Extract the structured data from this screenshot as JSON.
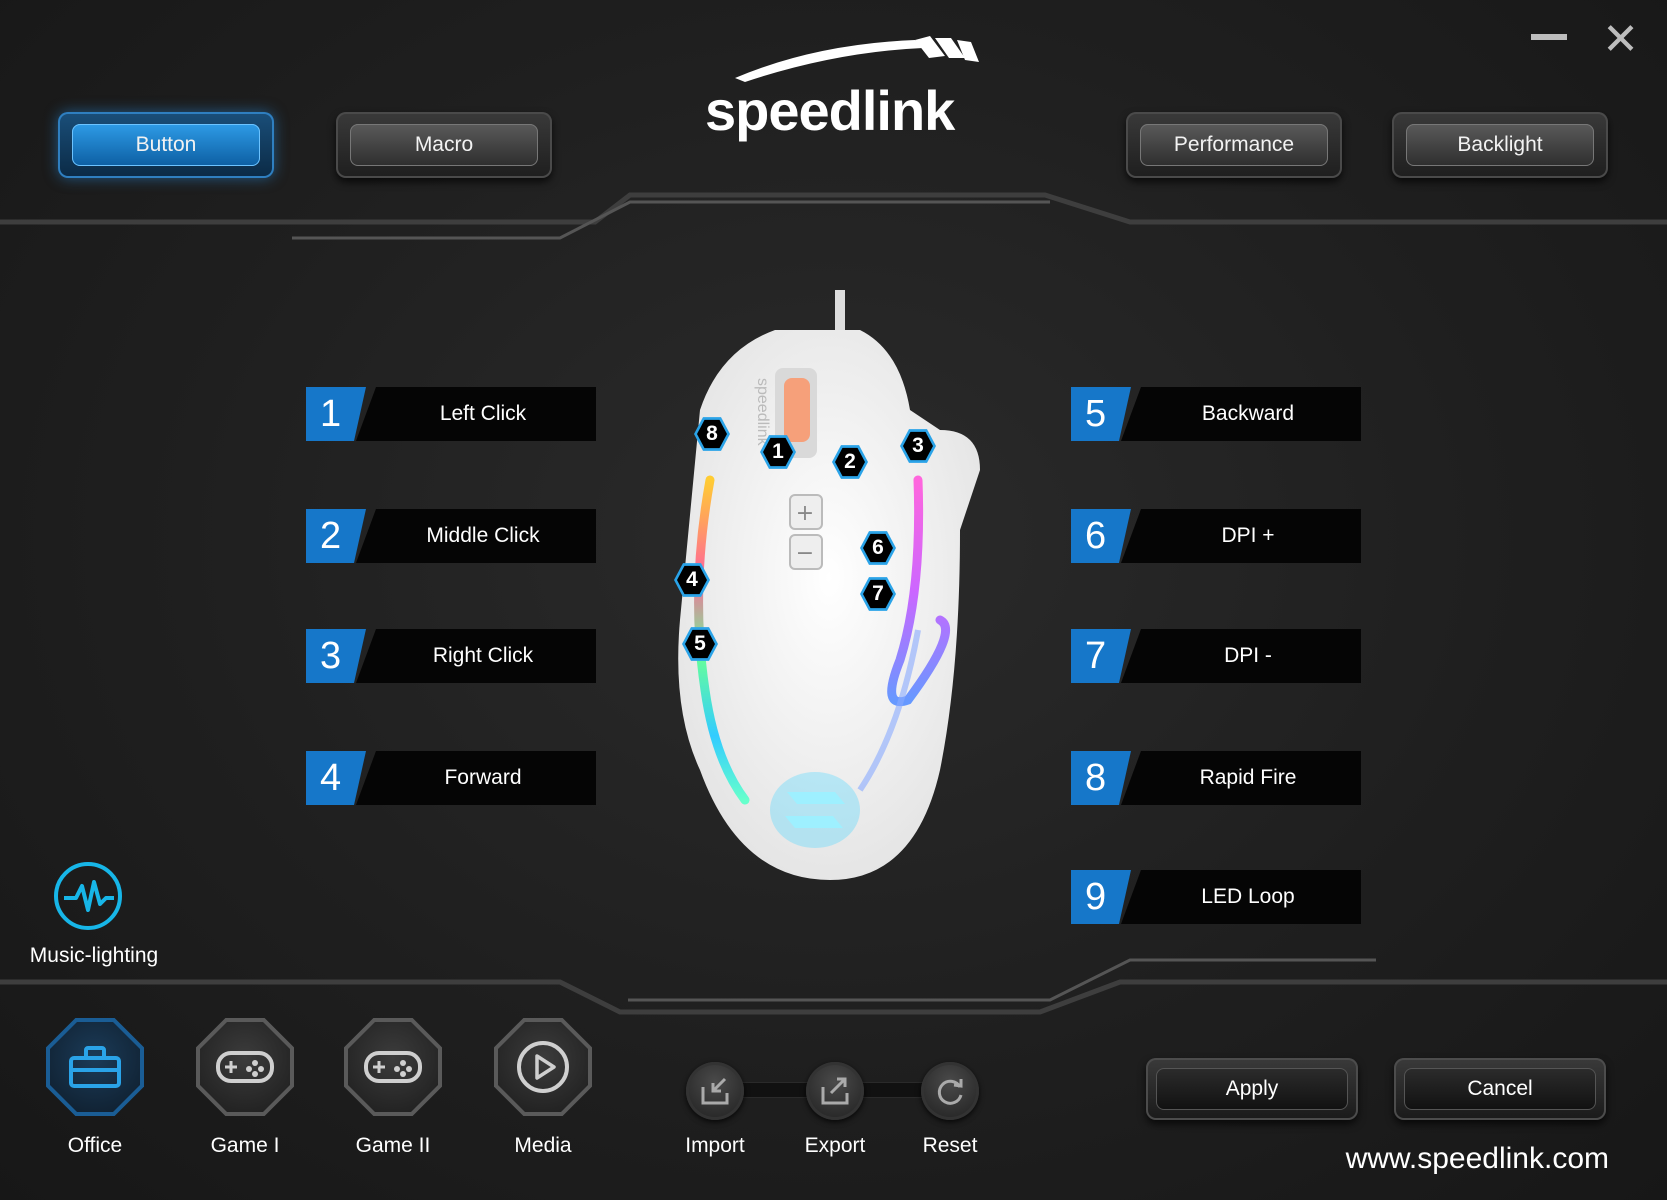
{
  "window": {
    "minimize_icon": "minimize-icon",
    "close_icon": "close-icon",
    "close_glyph": "✕"
  },
  "logo": {
    "text": "speedlink"
  },
  "tabs": [
    {
      "label": "Button",
      "active": true
    },
    {
      "label": "Macro",
      "active": false
    },
    {
      "label": "Performance",
      "active": false
    },
    {
      "label": "Backlight",
      "active": false
    }
  ],
  "mappings_left": [
    {
      "num": "1",
      "label": "Left Click"
    },
    {
      "num": "2",
      "label": "Middle Click"
    },
    {
      "num": "3",
      "label": "Right Click"
    },
    {
      "num": "4",
      "label": "Forward"
    }
  ],
  "mappings_right": [
    {
      "num": "5",
      "label": "Backward"
    },
    {
      "num": "6",
      "label": "DPI +"
    },
    {
      "num": "7",
      "label": "DPI -"
    },
    {
      "num": "8",
      "label": "Rapid Fire"
    },
    {
      "num": "9",
      "label": "LED Loop"
    }
  ],
  "mouse": {
    "brand_text": "speedlink",
    "markers": [
      "8",
      "1",
      "2",
      "3",
      "6",
      "4",
      "7",
      "5"
    ],
    "dpi_plus": "+",
    "dpi_minus": "−"
  },
  "music_lighting": {
    "label": "Music-lighting",
    "icon": "waveform-icon"
  },
  "profiles": [
    {
      "label": "Office",
      "icon": "toolbox-icon",
      "active": true
    },
    {
      "label": "Game I",
      "icon": "gamepad-icon",
      "active": false
    },
    {
      "label": "Game II",
      "icon": "gamepad-icon",
      "active": false
    },
    {
      "label": "Media",
      "icon": "play-icon",
      "active": false
    }
  ],
  "file_actions": [
    {
      "label": "Import",
      "icon": "import-icon"
    },
    {
      "label": "Export",
      "icon": "export-icon"
    },
    {
      "label": "Reset",
      "icon": "reset-icon"
    }
  ],
  "buttons": {
    "apply": "Apply",
    "cancel": "Cancel"
  },
  "website": "www.speedlink.com",
  "colors": {
    "accent": "#1677c9",
    "glow": "#2aa3e8",
    "background": "#1f1f1f"
  }
}
